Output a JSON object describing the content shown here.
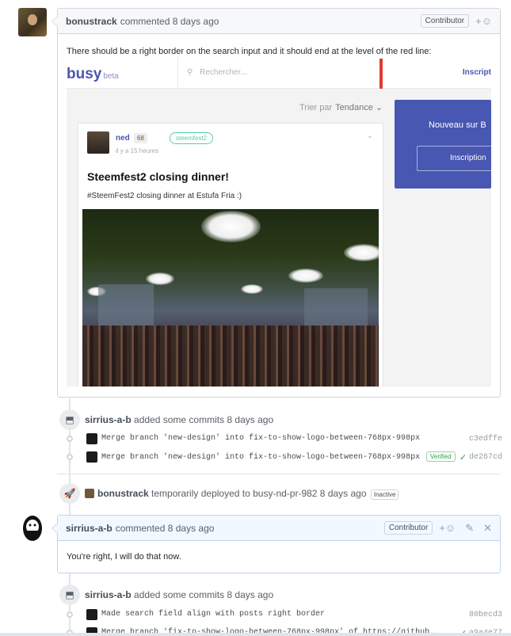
{
  "comment1": {
    "author": "bonustrack",
    "action": "commented 8 days ago",
    "badge": "Contributor",
    "reaction": "+☺",
    "body": "There should be a right border on the search input and it should end at the level of the red line:"
  },
  "screenshot": {
    "logo": "busy",
    "logo_beta": "beta",
    "search_placeholder": "Rechercher...",
    "top_signup": "Inscript",
    "sort_label": "Trier par",
    "sort_value": "Tendance ⌄",
    "post": {
      "author": "ned",
      "reputation": "68",
      "time": "il y a 15 heures",
      "tag": "steemfest2",
      "chevron": "⌄",
      "title": "Steemfest2 closing dinner!",
      "description": "#SteemFest2 closing dinner at Estufa Fria :)"
    },
    "side_title": "Nouveau sur B",
    "side_button": "Inscription"
  },
  "event1": {
    "author": "sirrius-a-b",
    "action": "added some commits 8 days ago",
    "commits": [
      {
        "message": "Merge branch 'new-design' into fix-to-show-logo-between-768px-998px",
        "sha": "c3edffe",
        "verified": ""
      },
      {
        "message": "Merge branch 'new-design' into fix-to-show-logo-between-768px-998px",
        "sha": "de267cd",
        "verified": "Verified"
      }
    ]
  },
  "deploy": {
    "author": "bonustrack",
    "action": "temporarily deployed to busy-nd-pr-982 8 days ago",
    "status": "Inactive"
  },
  "comment2": {
    "author": "sirrius-a-b",
    "action": "commented 8 days ago",
    "badge": "Contributor",
    "reaction": "+☺",
    "body": "You're right, I will do that now."
  },
  "event2": {
    "author": "sirrius-a-b",
    "action": "added some commits 8 days ago",
    "commits": [
      {
        "message": "Made search field align with posts right border",
        "sha": "80becd3"
      },
      {
        "message": "Merge branch 'fix-to-show-logo-between-768px-998px' of https://github…",
        "sha": "a9a4e77"
      }
    ]
  }
}
